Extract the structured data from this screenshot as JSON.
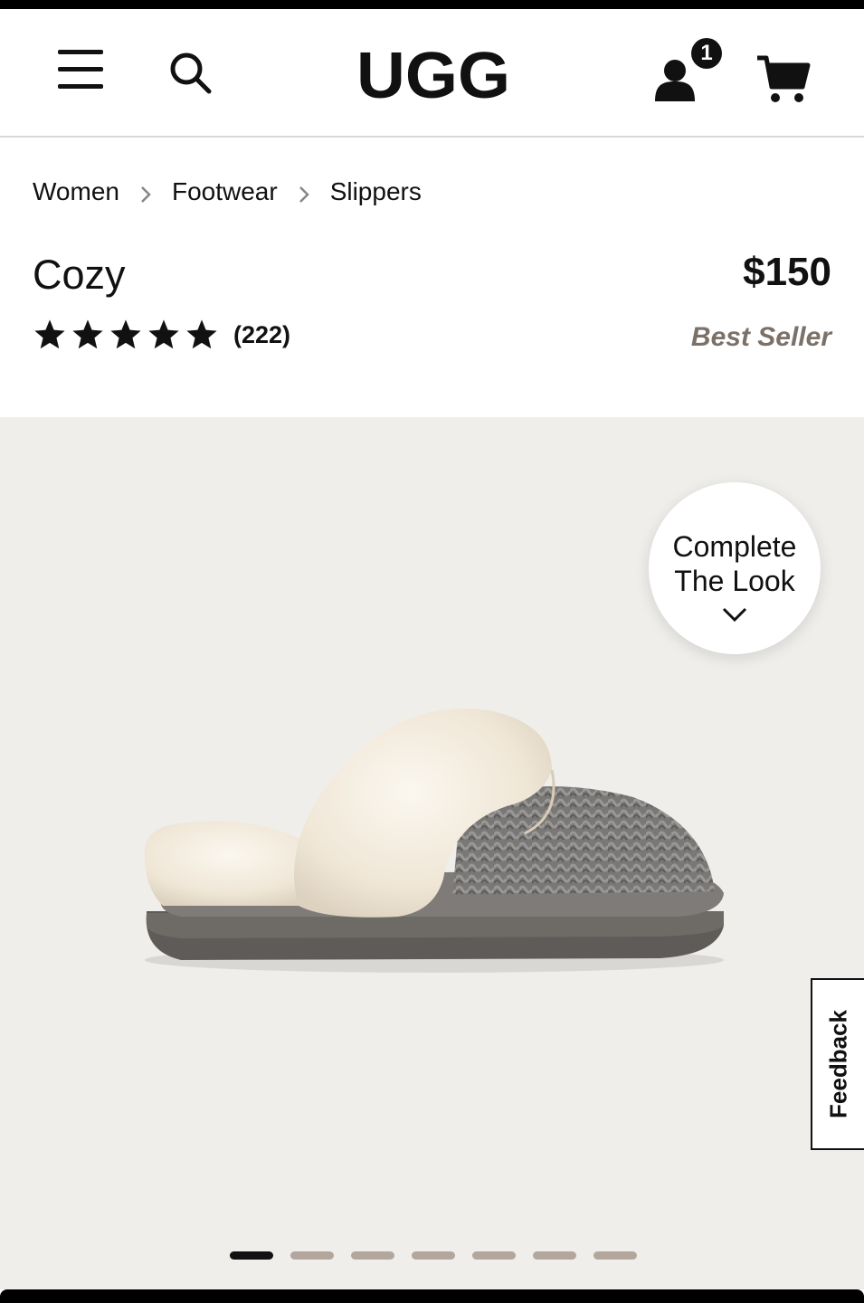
{
  "header": {
    "logo_text": "UGG",
    "icons": [
      "hamburger-menu-icon",
      "search-icon",
      "account-icon",
      "cart-icon"
    ],
    "account_badge_count": "1"
  },
  "breadcrumb": [
    {
      "label": "Women"
    },
    {
      "label": "Footwear"
    },
    {
      "label": "Slippers"
    }
  ],
  "product": {
    "name": "Cozy",
    "price": "$150",
    "badge": "Best Seller",
    "rating": 5,
    "rating_max": 5,
    "review_count": "(222)"
  },
  "gallery": {
    "complete_the_look_line1": "Complete",
    "complete_the_look_line2": "The Look",
    "image_count": 7,
    "active_index": 0
  },
  "feedback_tab": {
    "label": "Feedback"
  },
  "colors": {
    "background": "#ffffff",
    "gallery_bg": "#efeeeb",
    "best_seller": "#7b7169",
    "dot_inactive": "#b3a79d",
    "dot_active": "#111111"
  }
}
